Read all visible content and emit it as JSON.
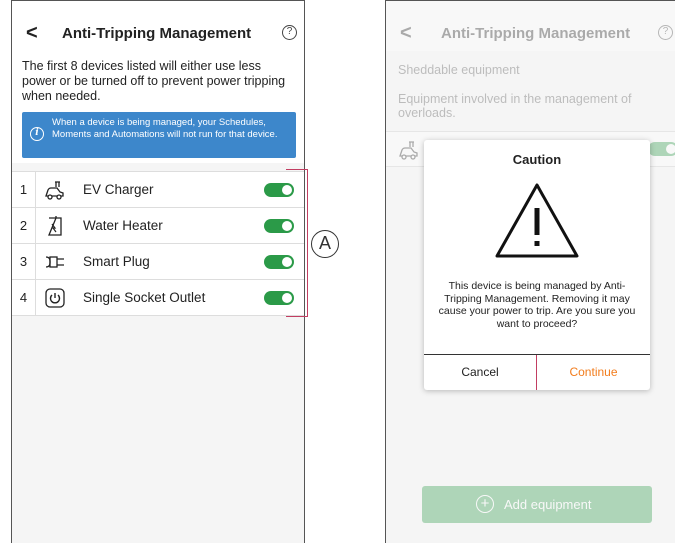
{
  "colors": {
    "accent_green": "#2b9a48",
    "info_blue": "#3d87cb",
    "callout_red": "#c23e62",
    "continue_orange": "#f27c1c"
  },
  "left_screen": {
    "header": {
      "back_icon": "<",
      "title": "Anti-Tripping Management",
      "help_icon": "?"
    },
    "intro_text": "The first 8 devices listed will either use less power or  be turned off to prevent power tripping when needed.",
    "info_box": {
      "icon": "i",
      "text": "When a device is being managed, your Schedules, Moments and Automations will not run for that device."
    },
    "devices": [
      {
        "number": "1",
        "icon": "ev-charger-icon",
        "label": "EV Charger",
        "enabled": true
      },
      {
        "number": "2",
        "icon": "water-heater-icon",
        "label": "Water Heater",
        "enabled": true
      },
      {
        "number": "3",
        "icon": "smart-plug-icon",
        "label": "Smart Plug",
        "enabled": true
      },
      {
        "number": "4",
        "icon": "socket-outlet-icon",
        "label": "Single Socket Outlet",
        "enabled": true
      }
    ],
    "callout_label": "A"
  },
  "right_screen": {
    "header": {
      "back_icon": "<",
      "title": "Anti-Tripping Management",
      "help_icon": "?"
    },
    "section_title": "Sheddable equipment",
    "section_description": "Equipment involved in the management of overloads.",
    "add_button_label": "Add equipment",
    "dialog": {
      "title": "Caution",
      "message": "This device is being managed by Anti-Tripping Management. Removing it may cause your power to trip. Are you sure you want to proceed?",
      "cancel_label": "Cancel",
      "continue_label": "Continue"
    }
  }
}
